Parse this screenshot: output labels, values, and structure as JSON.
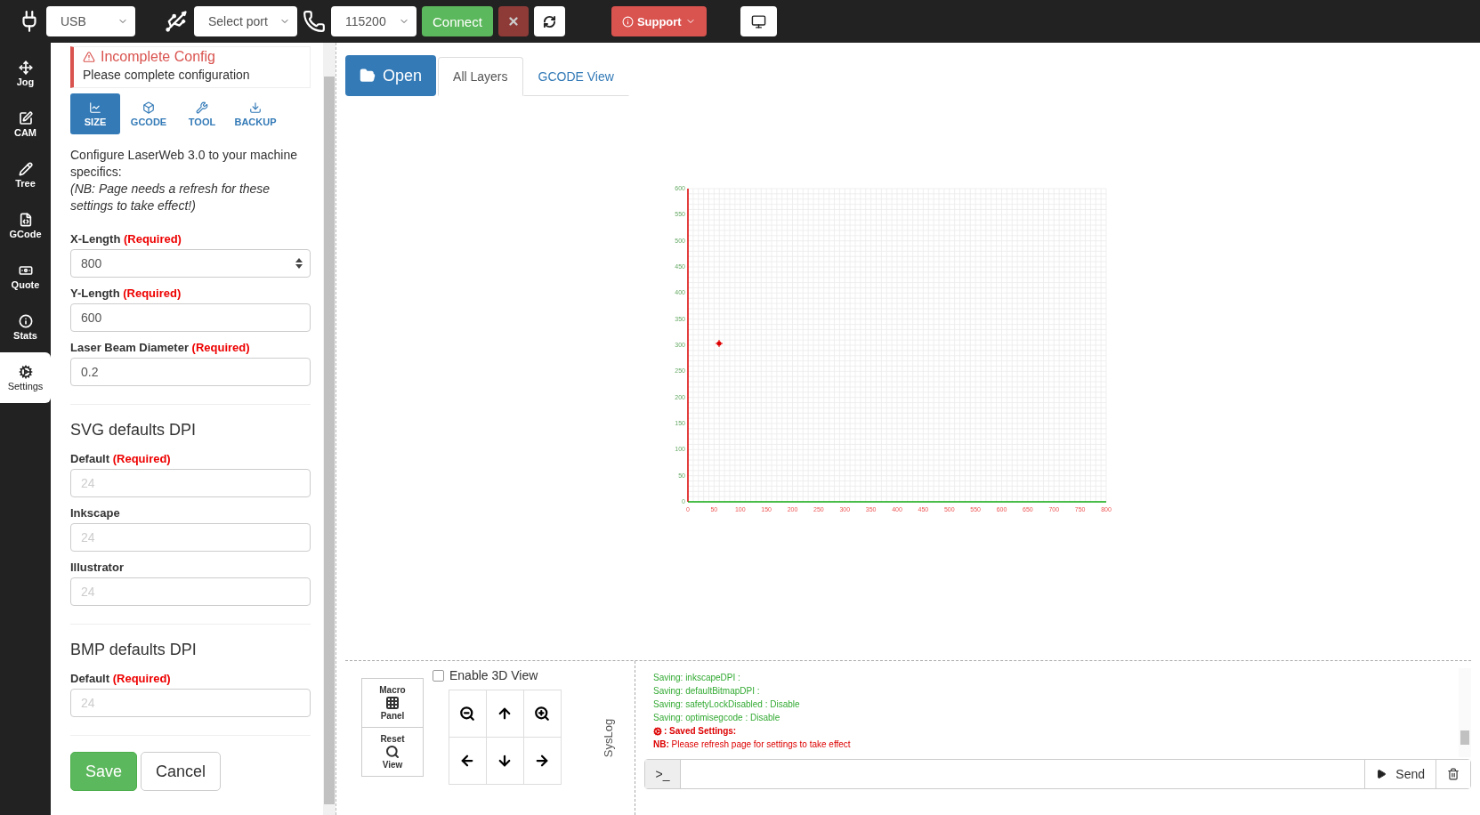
{
  "toolbar": {
    "connection": "USB",
    "port": "Select port",
    "baud": "115200",
    "connect": "Connect",
    "support": "Support"
  },
  "nav": [
    {
      "label": "Jog",
      "selected": false
    },
    {
      "label": "CAM",
      "selected": false
    },
    {
      "label": "Tree",
      "selected": false
    },
    {
      "label": "GCode",
      "selected": false
    },
    {
      "label": "Quote",
      "selected": false
    },
    {
      "label": "Stats",
      "selected": false
    },
    {
      "label": "Settings",
      "selected": true
    }
  ],
  "settings": {
    "alert": {
      "title": "Incomplete Config",
      "text": "Please complete configuration"
    },
    "tabs": [
      {
        "label": "SIZE",
        "selected": true
      },
      {
        "label": "GCODE",
        "selected": false
      },
      {
        "label": "TOOL",
        "selected": false
      },
      {
        "label": "BACKUP",
        "selected": false
      }
    ],
    "description": "Configure LaserWeb 3.0 to your machine specifics:",
    "note": "(NB: Page needs a refresh for these settings to take effect!)",
    "sections": [
      {
        "fields": [
          {
            "label": "X-Length",
            "tag": "(Required)",
            "value": "800",
            "kind": "number"
          },
          {
            "label": "Y-Length",
            "tag": "(Required)",
            "value": "600",
            "kind": "text"
          },
          {
            "label": "Laser Beam Diameter",
            "tag": "(Required)",
            "value": "0.2",
            "kind": "text"
          }
        ]
      },
      {
        "heading": "SVG defaults DPI",
        "fields": [
          {
            "label": "Default",
            "tag": "(Required)",
            "placeholder": "24",
            "kind": "text"
          },
          {
            "label": "Inkscape",
            "placeholder": "24",
            "kind": "text"
          },
          {
            "label": "Illustrator",
            "placeholder": "24",
            "kind": "text"
          }
        ]
      },
      {
        "heading": "BMP defaults DPI",
        "fields": [
          {
            "label": "Default",
            "tag": "(Required)",
            "placeholder": "24",
            "kind": "text"
          }
        ]
      }
    ],
    "buttons": {
      "save": "Save",
      "cancel": "Cancel"
    }
  },
  "view": {
    "open": "Open",
    "tabs": [
      {
        "label": "All Layers",
        "selected": true
      },
      {
        "label": "GCODE View",
        "selected": false
      }
    ],
    "x_ticks": [
      "0",
      "50",
      "100",
      "150",
      "200",
      "250",
      "300",
      "350",
      "400",
      "450",
      "500",
      "550",
      "600",
      "650",
      "700",
      "750",
      "800"
    ],
    "y_ticks": [
      "600",
      "550",
      "500",
      "450",
      "400",
      "350",
      "300",
      "250",
      "200",
      "150",
      "100",
      "50",
      "0"
    ]
  },
  "controls": {
    "macro": [
      "Macro",
      "Panel"
    ],
    "reset": [
      "Reset",
      "View"
    ],
    "enable_3d": {
      "label": "Enable 3D View",
      "checked": false
    },
    "syslog": "SysLog"
  },
  "log": [
    {
      "kind": "saving",
      "text": "Saving: inkscapeDPI :"
    },
    {
      "kind": "saving",
      "text": "Saving: defaultBitmapDPI :"
    },
    {
      "kind": "saving",
      "text": "Saving: safetyLockDisabled : Disable"
    },
    {
      "kind": "saving",
      "text": "Saving: optimisegcode : Disable"
    },
    {
      "kind": "saved",
      "text": ": Saved Settings:"
    },
    {
      "kind": "note",
      "text": "**NB:** Please refresh page for settings to take effect"
    }
  ],
  "console": {
    "prompt": ">_",
    "send": "Send"
  }
}
